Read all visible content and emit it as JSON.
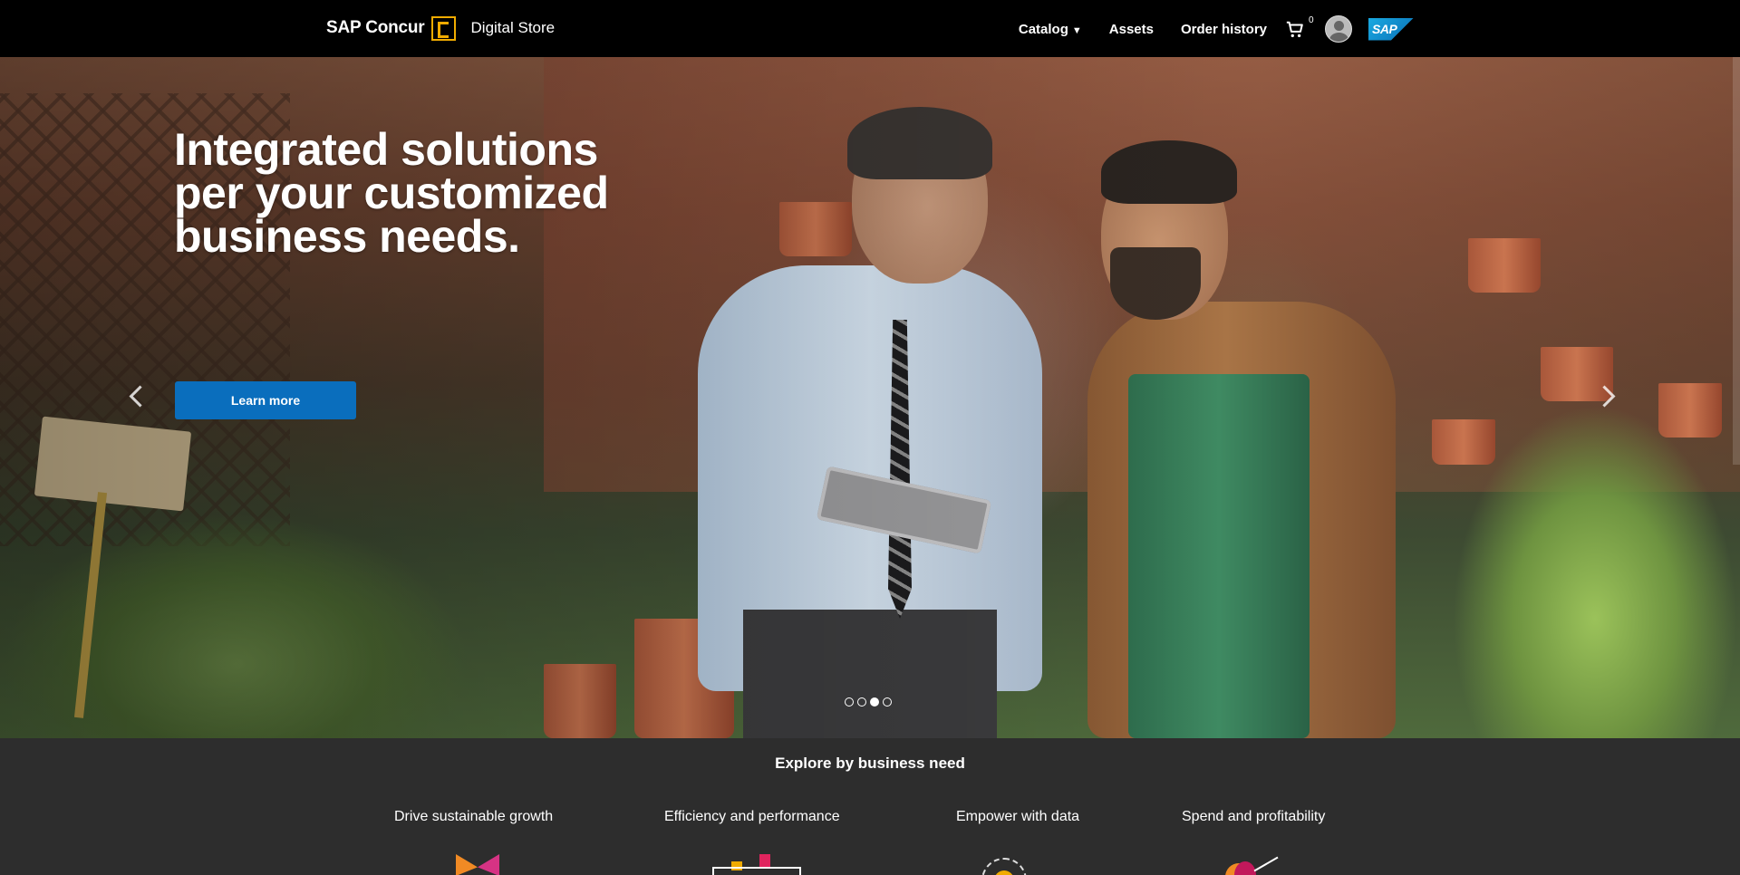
{
  "header": {
    "brand": "SAP Concur",
    "store_label": "Digital Store",
    "nav": {
      "catalog": "Catalog",
      "catalog_caret": "▼",
      "assets": "Assets",
      "order_history": "Order history",
      "cart_count": "0"
    },
    "sap_logo": "SAP"
  },
  "hero": {
    "title": "Integrated solutions per your customized business needs.",
    "cta": "Learn more",
    "slides": 4,
    "active_slide": 3
  },
  "explore": {
    "title": "Explore by business need",
    "needs": [
      {
        "label": "Drive sustainable growth",
        "icon": "butterfly-icon"
      },
      {
        "label": "Efficiency and performance",
        "icon": "board-icon"
      },
      {
        "label": "Empower with data",
        "icon": "data-icon"
      },
      {
        "label": "Spend and profitability",
        "icon": "spend-icon"
      }
    ]
  },
  "colors": {
    "accent": "#f0ab00",
    "cta_blue": "#0a6ebd",
    "explore_bg": "#2d2d2d"
  }
}
